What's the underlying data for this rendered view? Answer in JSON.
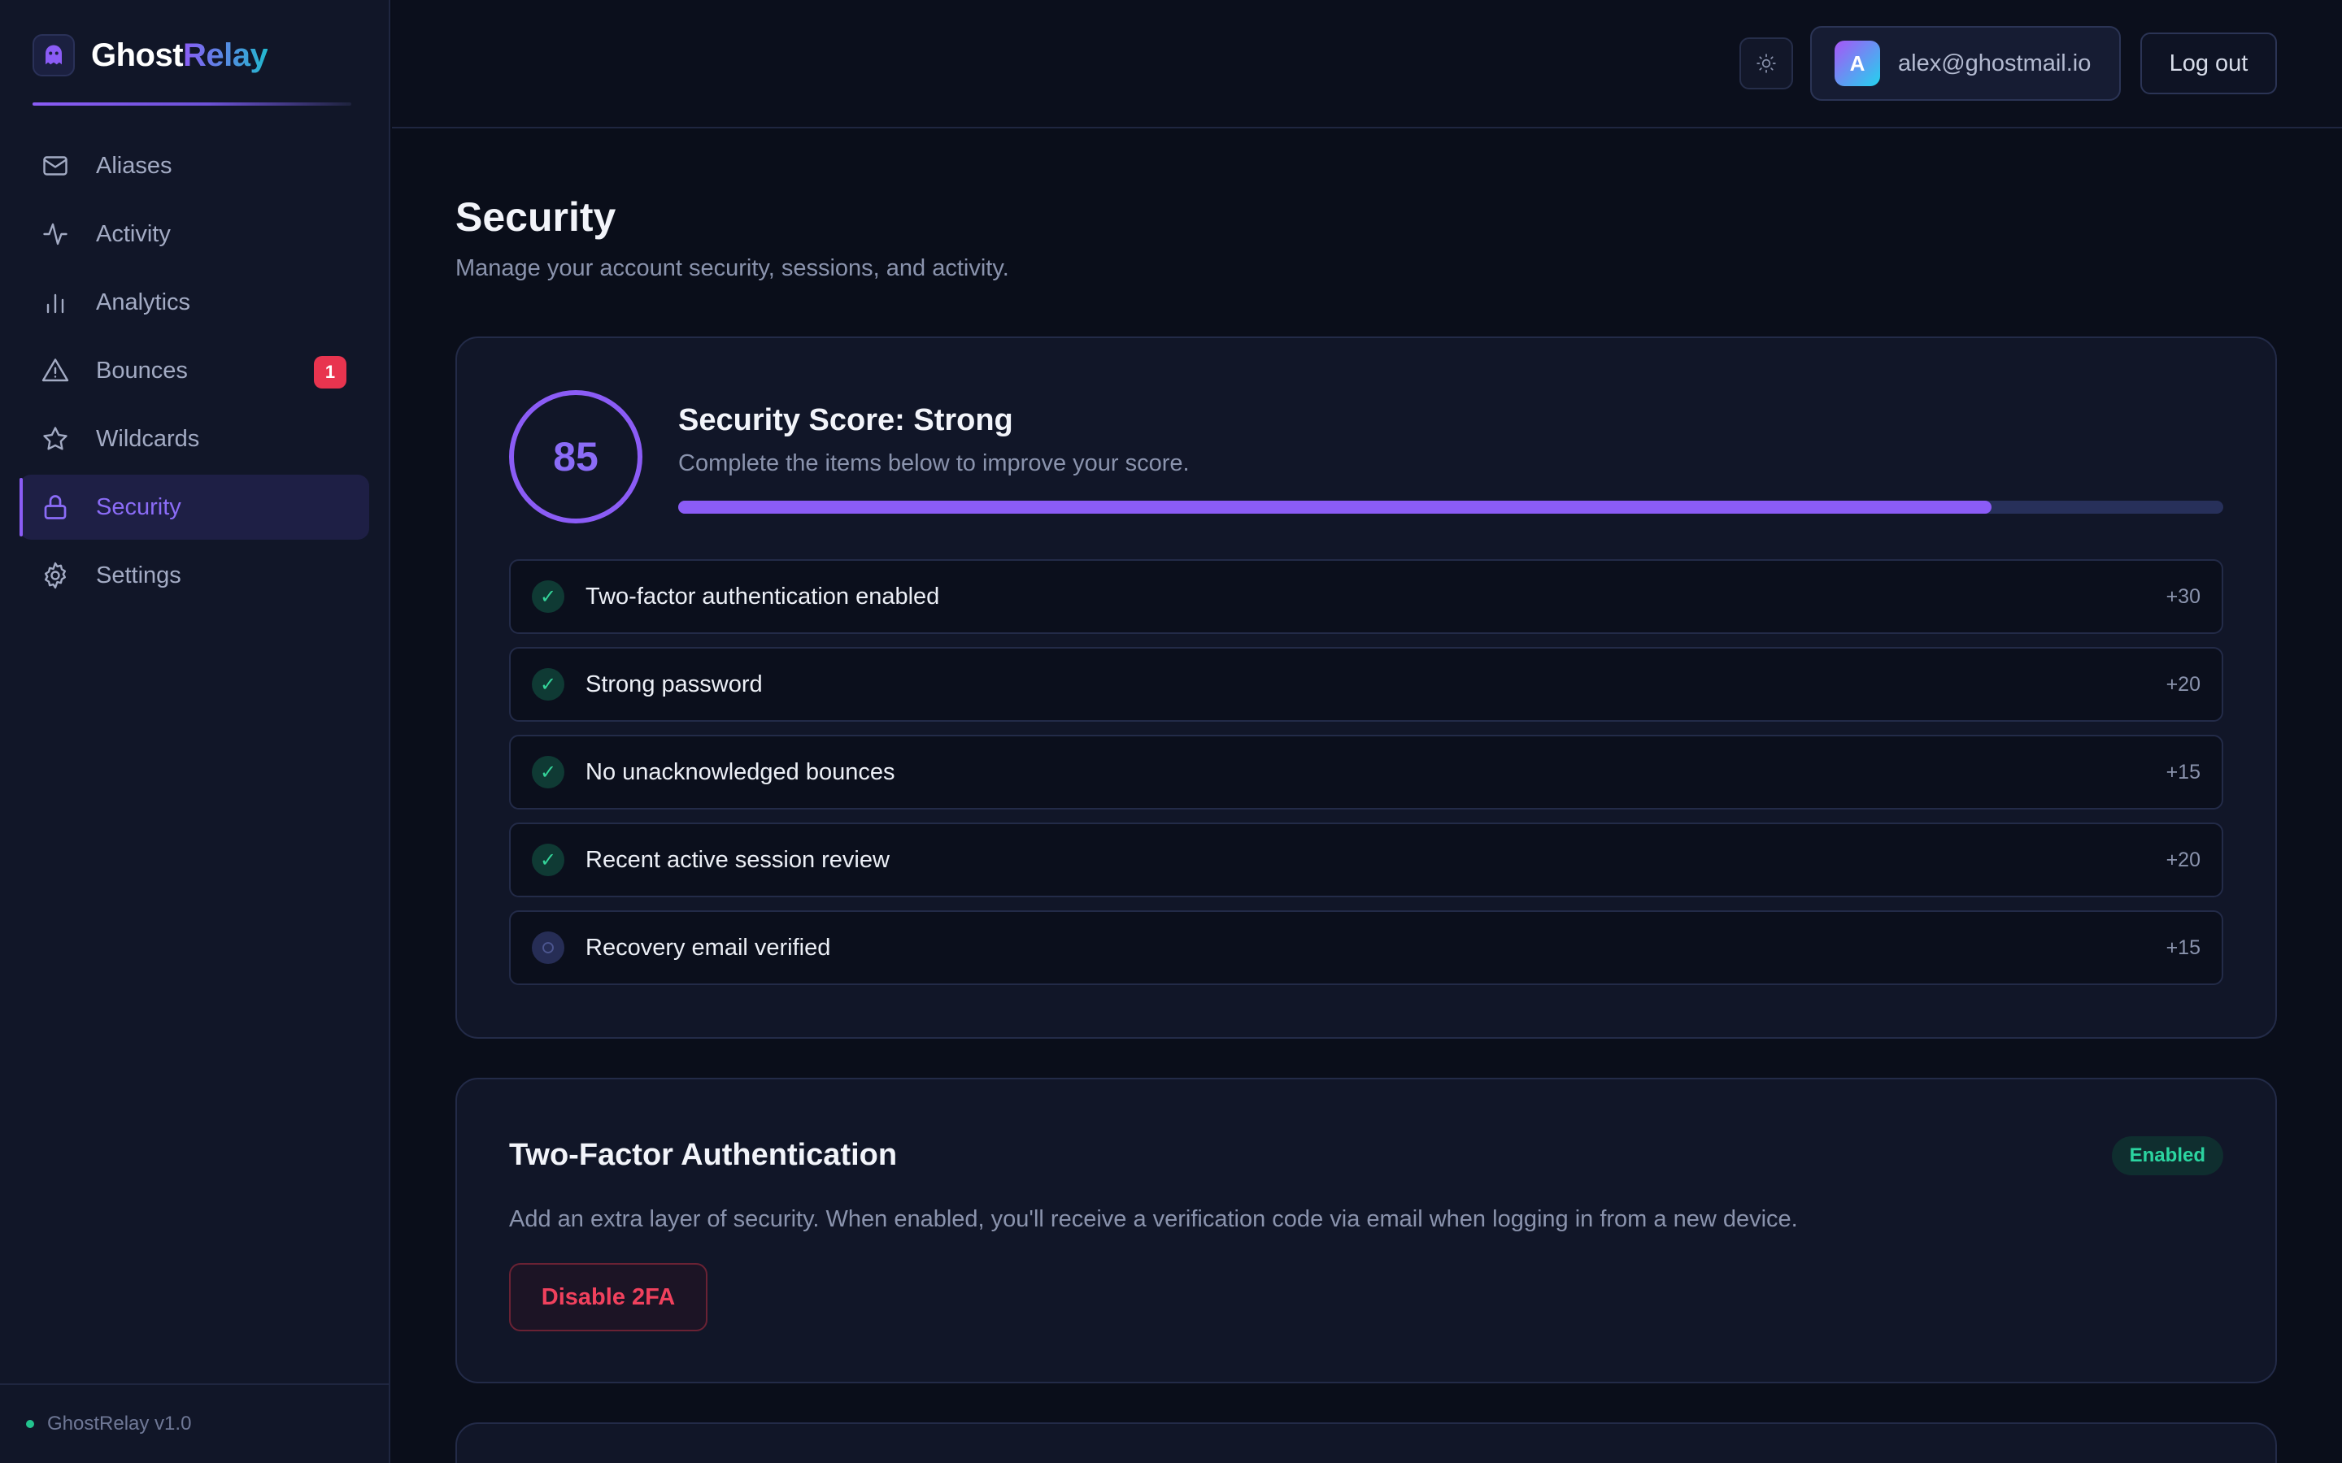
{
  "brand": {
    "name_part1": "Ghost",
    "name_part2": "Relay",
    "logo_icon": "ghost-icon"
  },
  "sidebar": {
    "items": [
      {
        "label": "Aliases",
        "icon": "mail-icon"
      },
      {
        "label": "Activity",
        "icon": "activity-icon"
      },
      {
        "label": "Analytics",
        "icon": "bar-chart-icon"
      },
      {
        "label": "Bounces",
        "icon": "alert-triangle-icon",
        "badge": "1"
      },
      {
        "label": "Wildcards",
        "icon": "star-icon"
      },
      {
        "label": "Security",
        "icon": "lock-icon",
        "active": true
      },
      {
        "label": "Settings",
        "icon": "gear-icon"
      }
    ],
    "footer": "GhostRelay v1.0"
  },
  "header": {
    "theme_icon": "sun-icon",
    "avatar_initial": "A",
    "user_email": "alex@ghostmail.io",
    "logout_label": "Log out"
  },
  "page": {
    "title": "Security",
    "subtitle": "Manage your account security, sessions, and activity."
  },
  "score": {
    "value": "85",
    "title": "Security Score: Strong",
    "description": "Complete the items below to improve your score.",
    "progress_fraction": 0.85,
    "checklist": [
      {
        "label": "Two-factor authentication enabled",
        "points": "+30",
        "done": true
      },
      {
        "label": "Strong password",
        "points": "+20",
        "done": true
      },
      {
        "label": "No unacknowledged bounces",
        "points": "+15",
        "done": true
      },
      {
        "label": "Recent active session review",
        "points": "+20",
        "done": true
      },
      {
        "label": "Recovery email verified",
        "points": "+15",
        "done": false
      }
    ]
  },
  "two_factor": {
    "title": "Two-Factor Authentication",
    "status": "Enabled",
    "description": "Add an extra layer of security. When enabled, you'll receive a verification code via email when logging in from a new device.",
    "button_label": "Disable 2FA"
  },
  "colors": {
    "accent": "#8b5cf6",
    "success": "#2bd4a0",
    "danger": "#f0415d",
    "background": "#0a0e1a",
    "surface": "#111628"
  }
}
